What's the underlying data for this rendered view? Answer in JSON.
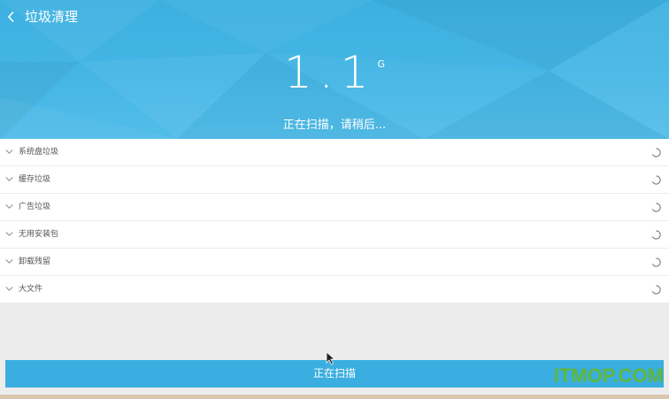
{
  "header": {
    "title": "垃圾清理",
    "size_value": "1.1",
    "size_unit": "G",
    "status_text": "正在扫描，请稍后..."
  },
  "categories": [
    {
      "label": "系统盘垃圾"
    },
    {
      "label": "缓存垃圾"
    },
    {
      "label": "广告垃圾"
    },
    {
      "label": "无用安装包"
    },
    {
      "label": "卸载残留"
    },
    {
      "label": "大文件"
    }
  ],
  "footer": {
    "button_label": "正在扫描"
  },
  "watermark": "ITMOP.COM",
  "colors": {
    "header_blue": "#45b6e5",
    "button_blue": "#3aaee0",
    "watermark_green": "#5fb73a",
    "background_gray": "#ececec"
  },
  "icons": {
    "back": "chevron-left-icon",
    "row_expand": "chevron-down-icon",
    "row_status": "loading-spinner-icon"
  }
}
